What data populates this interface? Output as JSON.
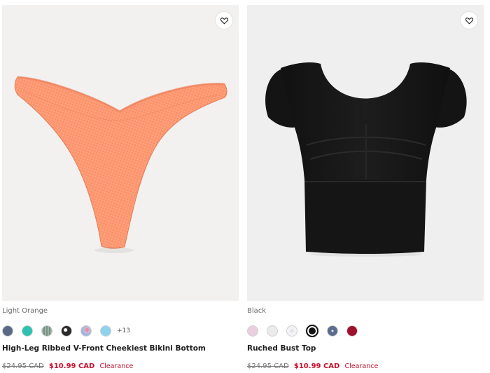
{
  "products": [
    {
      "color_name": "Light Orange",
      "title": "High-Leg Ribbed V-Front Cheekiest Bikini Bottom",
      "old_price": "$24.95 CAD",
      "new_price": "$10.99 CAD",
      "badge": "Clearance",
      "more_colors": "+13",
      "swatches": [
        "#5a6a86",
        "#2fc1b0",
        "#8fa69a",
        "#2a2a2a",
        "#c9b7d0",
        "#8ed3ec"
      ],
      "icons": [
        "heart-icon"
      ]
    },
    {
      "color_name": "Black",
      "title": "Ruched Bust Top",
      "old_price": "$24.95 CAD",
      "new_price": "$10.99 CAD",
      "badge": "Clearance",
      "swatches": [
        "#e9cfe0",
        "#ebebeb",
        "#ededf3",
        "#111111",
        "#5b6c8c",
        "#a0102c"
      ],
      "icons": [
        "heart-icon"
      ]
    }
  ],
  "colors": {
    "sale_red": "#c8102e",
    "bikini": "#ff9f7a",
    "top": "#151515"
  }
}
